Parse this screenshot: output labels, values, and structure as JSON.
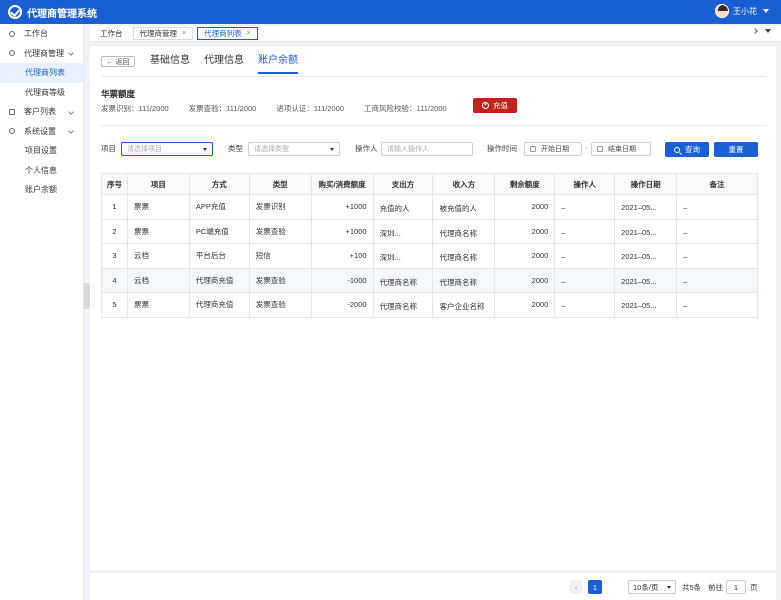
{
  "app": {
    "title": "代理商管理系统",
    "user": "王小花"
  },
  "sidebar": {
    "items": [
      {
        "label": "工作台"
      },
      {
        "label": "代理商管理",
        "children": [
          "代理商列表",
          "代理商等级"
        ]
      },
      {
        "label": "客户列表"
      },
      {
        "label": "系统设置",
        "children": [
          "项目设置",
          "个人信息",
          "账户余额"
        ]
      }
    ]
  },
  "tabs": {
    "workbench": "工作台",
    "agent_mgmt": "代理商管理",
    "agent_list": "代理商列表",
    "close": "×"
  },
  "page": {
    "back": "← 返回",
    "tabs": [
      "基础信息",
      "代理信息",
      "账户余额"
    ],
    "quota_title": "华票额度",
    "stats": [
      "发票识别：111/2000",
      "发票查验：111/2000",
      "进项认证：111/2000",
      "工商风险校验：111/2000"
    ],
    "recharge": "充值"
  },
  "filters": {
    "item_label": "项目",
    "item_placeholder": "请选择项目",
    "type_label": "类型",
    "type_placeholder": "请选择类型",
    "operator_label": "操作人",
    "operator_placeholder": "请输入操作人",
    "time_label": "操作时间",
    "start_date": "开始日期",
    "dash": "-",
    "end_date": "结束日期",
    "search": "查询",
    "reset": "重置"
  },
  "table": {
    "headers": [
      "序号",
      "项目",
      "方式",
      "类型",
      "购买/消费额度",
      "支出方",
      "收入方",
      "剩余额度",
      "操作人",
      "操作日期",
      "备注"
    ],
    "rows": [
      {
        "no": "1",
        "item": "票票",
        "method": "APP充值",
        "type": "发票识别",
        "amount": "+1000",
        "payer": "充值的人",
        "payee": "被充值的人",
        "balance": "2000",
        "operator": "–",
        "date": "2021–05...",
        "note": "–"
      },
      {
        "no": "2",
        "item": "票票",
        "method": "PC端充值",
        "type": "发票查验",
        "amount": "+1000",
        "payer": "深圳...",
        "payee": "代理商名称",
        "balance": "2000",
        "operator": "–",
        "date": "2021–05...",
        "note": "–"
      },
      {
        "no": "3",
        "item": "云档",
        "method": "平台后台",
        "type": "短信",
        "amount": "+100",
        "payer": "深圳...",
        "payee": "代理商名称",
        "balance": "2000",
        "operator": "–",
        "date": "2021–05...",
        "note": "–"
      },
      {
        "no": "4",
        "item": "云档",
        "method": "代理商充值",
        "type": "发票查验",
        "amount": "-1000",
        "payer": "代理商名称",
        "payee": "代理商名称",
        "balance": "2000",
        "operator": "–",
        "date": "2021–05...",
        "note": "–"
      },
      {
        "no": "5",
        "item": "票票",
        "method": "代理商充值",
        "type": "发票查验",
        "amount": "-2000",
        "payer": "代理商名称",
        "payee": "客户企业名称",
        "balance": "2000",
        "operator": "–",
        "date": "2021–05...",
        "note": "–"
      }
    ]
  },
  "pagination": {
    "prev": "‹",
    "current": "1",
    "page_size": "10条/页",
    "total": "共5条",
    "goto": "前往",
    "goto_value": "1",
    "unit": "页"
  },
  "colors": {
    "primary": "#1a5fd4",
    "recharge": "#c8201b",
    "positive": "#d9001b",
    "negative": "#52c41a"
  }
}
